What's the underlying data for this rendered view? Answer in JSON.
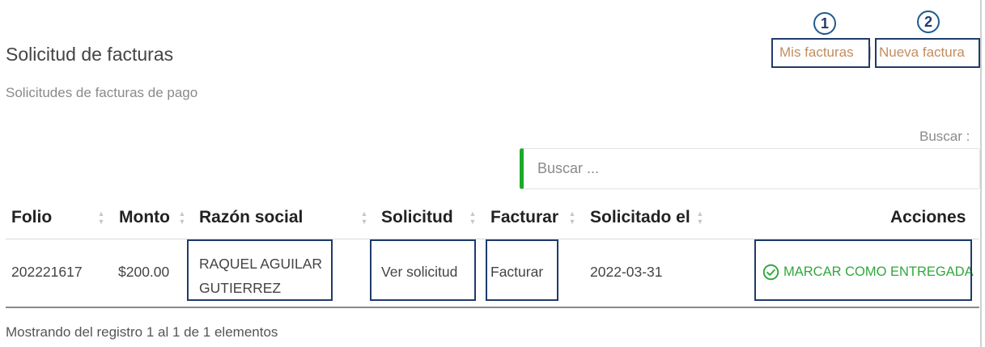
{
  "header": {
    "title": "Solicitud de facturas",
    "subtitle": "Solicitudes de facturas de pago"
  },
  "top_links": {
    "mis_facturas": "Mis facturas",
    "nueva_factura": "Nueva factura"
  },
  "annotations": {
    "badge_1": "1",
    "badge_2": "2"
  },
  "search": {
    "label": "Buscar :",
    "placeholder": "Buscar ..."
  },
  "table": {
    "columns": [
      "Folio",
      "Monto",
      "Razón social",
      "Solicitud",
      "Facturar",
      "Solicitado el",
      "Acciones"
    ],
    "rows": [
      {
        "folio": "202221617",
        "monto": "$200.00",
        "razon_social_line1": "RAQUEL AGUILAR",
        "razon_social_line2": "GUTIERREZ",
        "solicitud": "Ver solicitud",
        "facturar": "Facturar",
        "solicitado_el": "2022-03-31",
        "accion": "MARCAR COMO ENTREGADA"
      }
    ]
  },
  "footer": {
    "info": "Mostrando del registro 1 al 1 de 1 elementos"
  },
  "colors": {
    "link": "#c28d5e",
    "action_green": "#2fa83a",
    "highlight_box": "#1f3b6b",
    "search_accent": "#1aaa27"
  }
}
